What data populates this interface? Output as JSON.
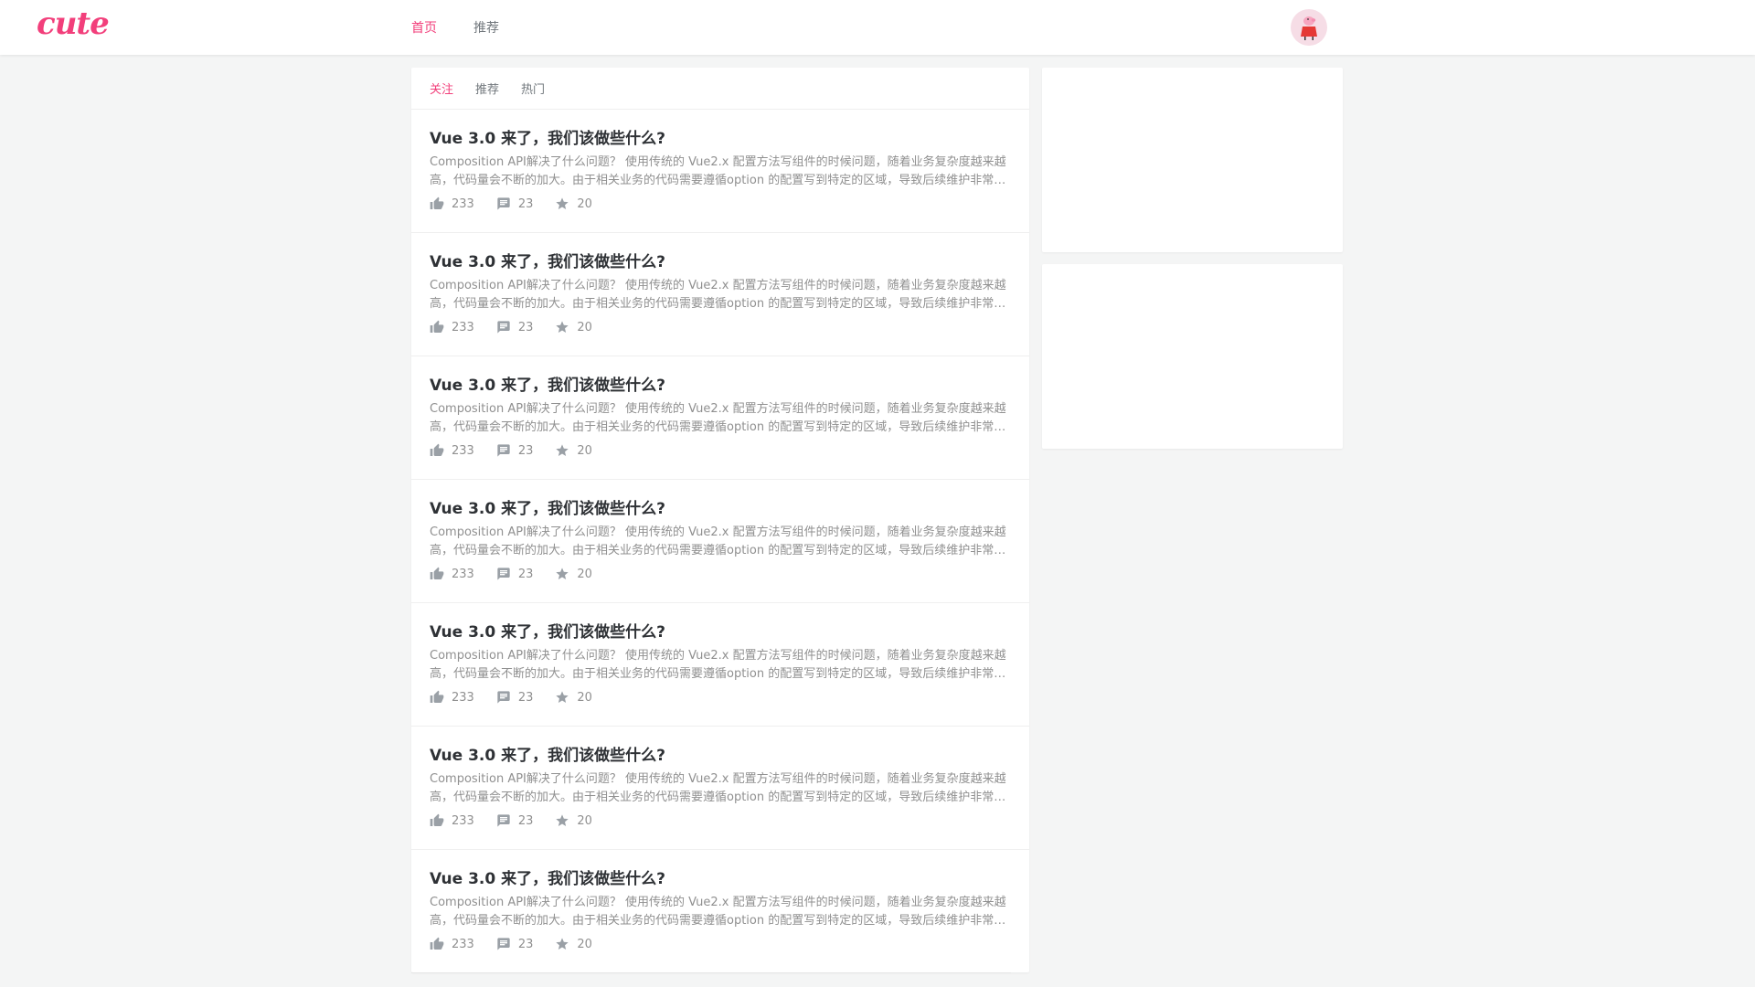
{
  "colors": {
    "accent": "#f23f7b",
    "text_secondary": "#909090",
    "background": "#f4f5f5"
  },
  "header": {
    "logo": "cute",
    "nav": [
      "首页",
      "推荐"
    ],
    "avatar_icon": "peppa-pig-avatar"
  },
  "main": {
    "tabs": [
      "关注",
      "推荐",
      "热门"
    ],
    "articles": [
      {
        "title": "Vue 3.0 来了，我们该做些什么?",
        "abstract": "Composition API解决了什么问题？ 使用传统的 Vue2.x 配置方法写组件的时候问题，随着业务复杂度越来越高，代码量会不断的加大。由于相关业务的代码需要遵循option 的配置写到特定的区域，导致后续维护非常复杂",
        "likes": "233",
        "comments": "23",
        "stars": "20"
      },
      {
        "title": "Vue 3.0 来了，我们该做些什么?",
        "abstract": "Composition API解决了什么问题？ 使用传统的 Vue2.x 配置方法写组件的时候问题，随着业务复杂度越来越高，代码量会不断的加大。由于相关业务的代码需要遵循option 的配置写到特定的区域，导致后续维护非常复杂",
        "likes": "233",
        "comments": "23",
        "stars": "20"
      },
      {
        "title": "Vue 3.0 来了，我们该做些什么?",
        "abstract": "Composition API解决了什么问题？ 使用传统的 Vue2.x 配置方法写组件的时候问题，随着业务复杂度越来越高，代码量会不断的加大。由于相关业务的代码需要遵循option 的配置写到特定的区域，导致后续维护非常复杂",
        "likes": "233",
        "comments": "23",
        "stars": "20"
      },
      {
        "title": "Vue 3.0 来了，我们该做些什么?",
        "abstract": "Composition API解决了什么问题？ 使用传统的 Vue2.x 配置方法写组件的时候问题，随着业务复杂度越来越高，代码量会不断的加大。由于相关业务的代码需要遵循option 的配置写到特定的区域，导致后续维护非常复杂",
        "likes": "233",
        "comments": "23",
        "stars": "20"
      },
      {
        "title": "Vue 3.0 来了，我们该做些什么?",
        "abstract": "Composition API解决了什么问题？ 使用传统的 Vue2.x 配置方法写组件的时候问题，随着业务复杂度越来越高，代码量会不断的加大。由于相关业务的代码需要遵循option 的配置写到特定的区域，导致后续维护非常复杂",
        "likes": "233",
        "comments": "23",
        "stars": "20"
      },
      {
        "title": "Vue 3.0 来了，我们该做些什么?",
        "abstract": "Composition API解决了什么问题？ 使用传统的 Vue2.x 配置方法写组件的时候问题，随着业务复杂度越来越高，代码量会不断的加大。由于相关业务的代码需要遵循option 的配置写到特定的区域，导致后续维护非常复杂",
        "likes": "233",
        "comments": "23",
        "stars": "20"
      },
      {
        "title": "Vue 3.0 来了，我们该做些什么?",
        "abstract": "Composition API解决了什么问题？ 使用传统的 Vue2.x 配置方法写组件的时候问题，随着业务复杂度越来越高，代码量会不断的加大。由于相关业务的代码需要遵循option 的配置写到特定的区域，导致后续维护非常复杂",
        "likes": "233",
        "comments": "23",
        "stars": "20"
      }
    ],
    "meta_icons": [
      "thumbs-up-icon",
      "comment-icon",
      "star-icon"
    ]
  }
}
